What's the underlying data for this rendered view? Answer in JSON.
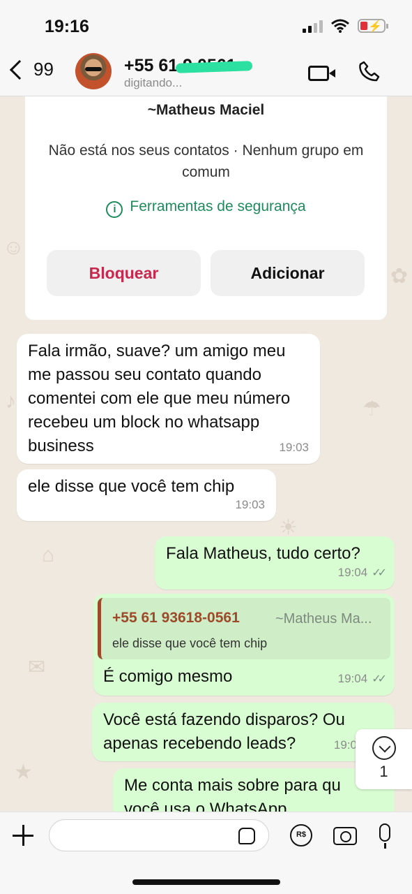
{
  "status_bar": {
    "time": "19:16"
  },
  "header": {
    "back_count": "99",
    "contact_phone": "+55 61 9 0561",
    "contact_status": "digitando..."
  },
  "info_card": {
    "name": "~Matheus Maciel",
    "subtitle": "Não está nos seus contatos · Nenhum grupo em comum",
    "security_label": "Ferramentas de segurança",
    "block_label": "Bloquear",
    "add_label": "Adicionar"
  },
  "messages": [
    {
      "direction": "in",
      "text": "Fala irmão, suave? um amigo meu me passou seu contato quando comentei com ele que meu número recebeu um block no whatsapp business",
      "time": "19:03"
    },
    {
      "direction": "in",
      "text": "ele disse que você tem chip",
      "time": "19:03"
    },
    {
      "direction": "out",
      "text": "Fala Matheus, tudo certo?",
      "time": "19:04",
      "ticks": "✓✓"
    },
    {
      "direction": "out",
      "text": "É comigo mesmo",
      "time": "19:04",
      "ticks": "✓✓",
      "quote": {
        "phone": "+55 61 93618-0561",
        "alias": "~Matheus Ma...",
        "text": "ele disse que você tem chip"
      }
    },
    {
      "direction": "out",
      "text": "Você está fazendo disparos? Ou apenas recebendo leads?",
      "time": "19:0"
    },
    {
      "direction": "out",
      "text": "Me conta mais sobre para qu você usa o WhatsApp"
    }
  ],
  "scroll_button": {
    "count": "1"
  },
  "composer": {
    "input_value": "",
    "pay_label": "R$"
  },
  "colors": {
    "outgoing_bubble": "#d9fdd3",
    "incoming_bubble": "#ffffff",
    "security_green": "#1f8a5c",
    "block_red": "#c8284e",
    "quote_accent": "#9c4a2a"
  }
}
